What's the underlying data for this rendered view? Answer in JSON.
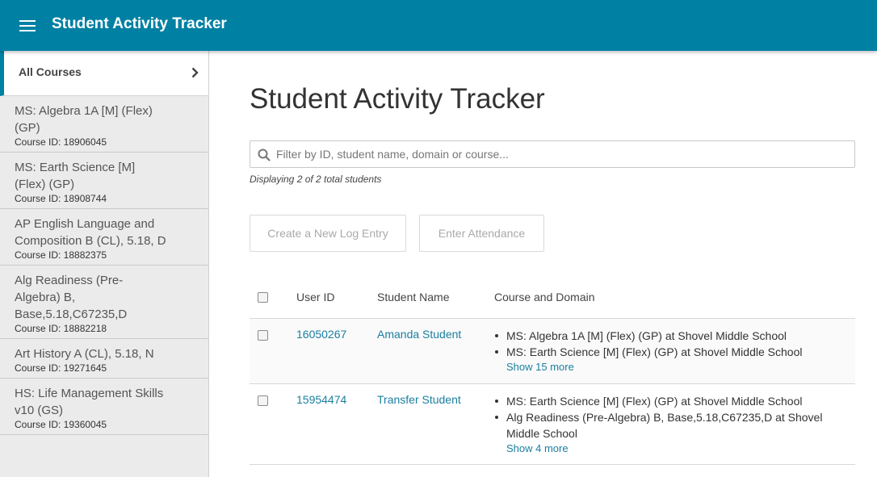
{
  "header": {
    "title": "Student Activity Tracker",
    "menu_icon": "hamburger-menu-icon",
    "background": "#0080a3"
  },
  "sidebar": {
    "all_courses": "All Courses",
    "items": [
      {
        "name": "MS: Algebra 1A [M] (Flex) (GP)",
        "course_id": "Course ID: 18906045"
      },
      {
        "name": "MS: Earth Science [M] (Flex) (GP)",
        "course_id": "Course ID: 18908744"
      },
      {
        "name": "AP English Language and Composition B (CL), 5.18, D",
        "course_id": "Course ID: 18882375"
      },
      {
        "name": "Alg Readiness (Pre-Algebra) B, Base,5.18,C67235,D",
        "course_id": "Course ID: 18882218"
      },
      {
        "name": "Art History A (CL), 5.18, N",
        "course_id": "Course ID: 19271645"
      },
      {
        "name": "HS: Life Management Skills v10 (GS)",
        "course_id": "Course ID: 19360045"
      }
    ]
  },
  "main": {
    "title": "Student Activity Tracker",
    "filter_placeholder": "Filter by ID, student name, domain or course...",
    "filter_value": "",
    "count_text": "Displaying 2 of 2 total students",
    "buttons": {
      "new_log": "Create a New Log Entry",
      "attendance": "Enter Attendance"
    },
    "table": {
      "columns": [
        "User ID",
        "Student Name",
        "Course and Domain"
      ],
      "rows": [
        {
          "user_id": "16050267",
          "student_name": "Amanda Student",
          "courses": [
            "MS: Algebra 1A [M] (Flex) (GP) at Shovel Middle School",
            "MS: Earth Science [M] (Flex) (GP) at Shovel Middle School"
          ],
          "more": "Show 15 more"
        },
        {
          "user_id": "15954474",
          "student_name": "Transfer Student",
          "courses": [
            "MS: Earth Science [M] (Flex) (GP) at Shovel Middle School",
            "Alg Readiness (Pre-Algebra) B, Base,5.18,C67235,D at Shovel Middle School"
          ],
          "more": "Show 4 more"
        }
      ]
    }
  },
  "colors": {
    "accent": "#0080a3",
    "link": "#1a7fa0",
    "sidebar_bg": "#ebebeb"
  }
}
